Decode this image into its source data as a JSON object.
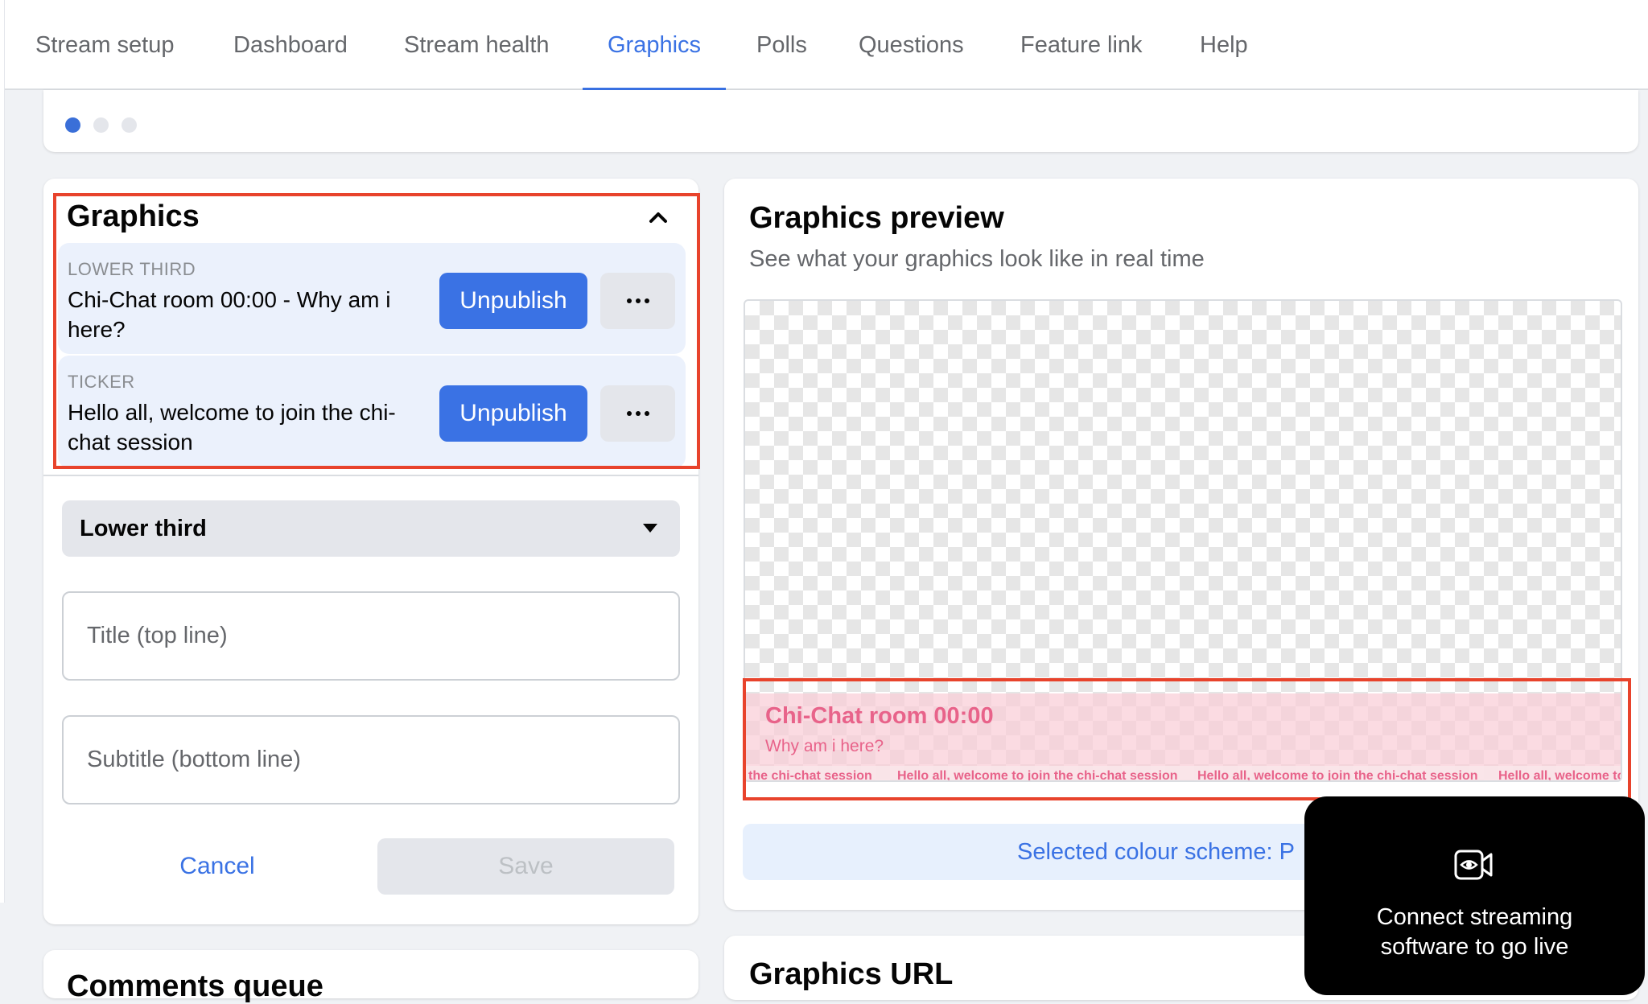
{
  "nav": {
    "tabs": [
      {
        "label": "Stream setup",
        "active": false
      },
      {
        "label": "Dashboard",
        "active": false
      },
      {
        "label": "Stream health",
        "active": false
      },
      {
        "label": "Graphics",
        "active": true
      },
      {
        "label": "Polls",
        "active": false
      },
      {
        "label": "Questions",
        "active": false
      },
      {
        "label": "Feature link",
        "active": false
      },
      {
        "label": "Help",
        "active": false
      }
    ]
  },
  "carousel": {
    "page_count": 3,
    "active_index": 0
  },
  "graphics_panel": {
    "title": "Graphics",
    "items": [
      {
        "kind": "LOWER THIRD",
        "text": "Chi-Chat room 00:00 - Why am i here?",
        "action_label": "Unpublish"
      },
      {
        "kind": "TICKER",
        "text": "Hello all, welcome to join the chi-chat session",
        "action_label": "Unpublish"
      }
    ],
    "graphic_type_select": {
      "selected": "Lower third"
    },
    "title_field": {
      "value": "",
      "placeholder": "Title (top line)"
    },
    "subtitle_field": {
      "value": "",
      "placeholder": "Subtitle (bottom line)"
    },
    "cancel_label": "Cancel",
    "save_label": "Save"
  },
  "comments_panel": {
    "title": "Comments queue"
  },
  "preview_panel": {
    "title": "Graphics preview",
    "subtitle": "See what your graphics look like in real time",
    "lower_third": {
      "title": "Chi-Chat room 00:00",
      "subtitle": "Why am i here?"
    },
    "ticker": {
      "segments": [
        "the chi-chat session",
        "Hello all, welcome to join the chi-chat session",
        "Hello all, welcome to join the chi-chat session",
        "Hello all, welcome to"
      ]
    },
    "colour_scheme_label": "Selected colour scheme: P"
  },
  "url_panel": {
    "title": "Graphics URL"
  },
  "toast": {
    "icon": "video-camera-eye-icon",
    "line1": "Connect streaming",
    "line2": "software to go live"
  },
  "colors": {
    "accent": "#3a72e4",
    "highlight": "#e8432c",
    "graphic_pink": "#e8638a"
  }
}
